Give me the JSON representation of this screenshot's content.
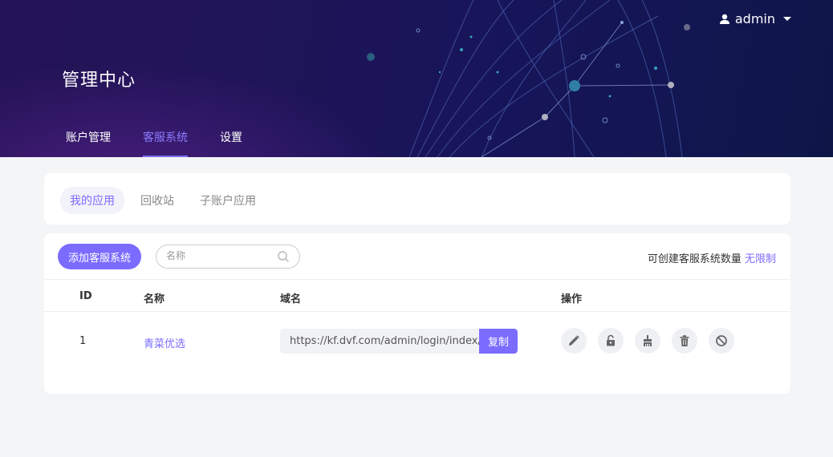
{
  "header": {
    "title": "管理中心",
    "user": {
      "name": "admin",
      "icon": "user-icon"
    },
    "nav": [
      {
        "label": "账户管理",
        "active": false
      },
      {
        "label": "客服系统",
        "active": true
      },
      {
        "label": "设置",
        "active": false
      }
    ]
  },
  "subtabs": [
    {
      "label": "我的应用",
      "active": true
    },
    {
      "label": "回收站",
      "active": false
    },
    {
      "label": "子账户应用",
      "active": false
    }
  ],
  "toolbar": {
    "add_label": "添加客服系统",
    "search_placeholder": "名称",
    "quota_label": "可创建客服系统数量",
    "quota_value": "无限制"
  },
  "table": {
    "columns": [
      "ID",
      "名称",
      "域名",
      "操作"
    ],
    "rows": [
      {
        "id": "1",
        "name": "青菜优选",
        "domain": "https://kf.dvf.com/admin/login/index/b",
        "copy_label": "复制",
        "actions": [
          "edit-icon",
          "unlock-icon",
          "brush-icon",
          "trash-icon",
          "disable-icon"
        ]
      }
    ]
  },
  "colors": {
    "accent": "#7b6cff",
    "header_bg": "#1e1458"
  }
}
